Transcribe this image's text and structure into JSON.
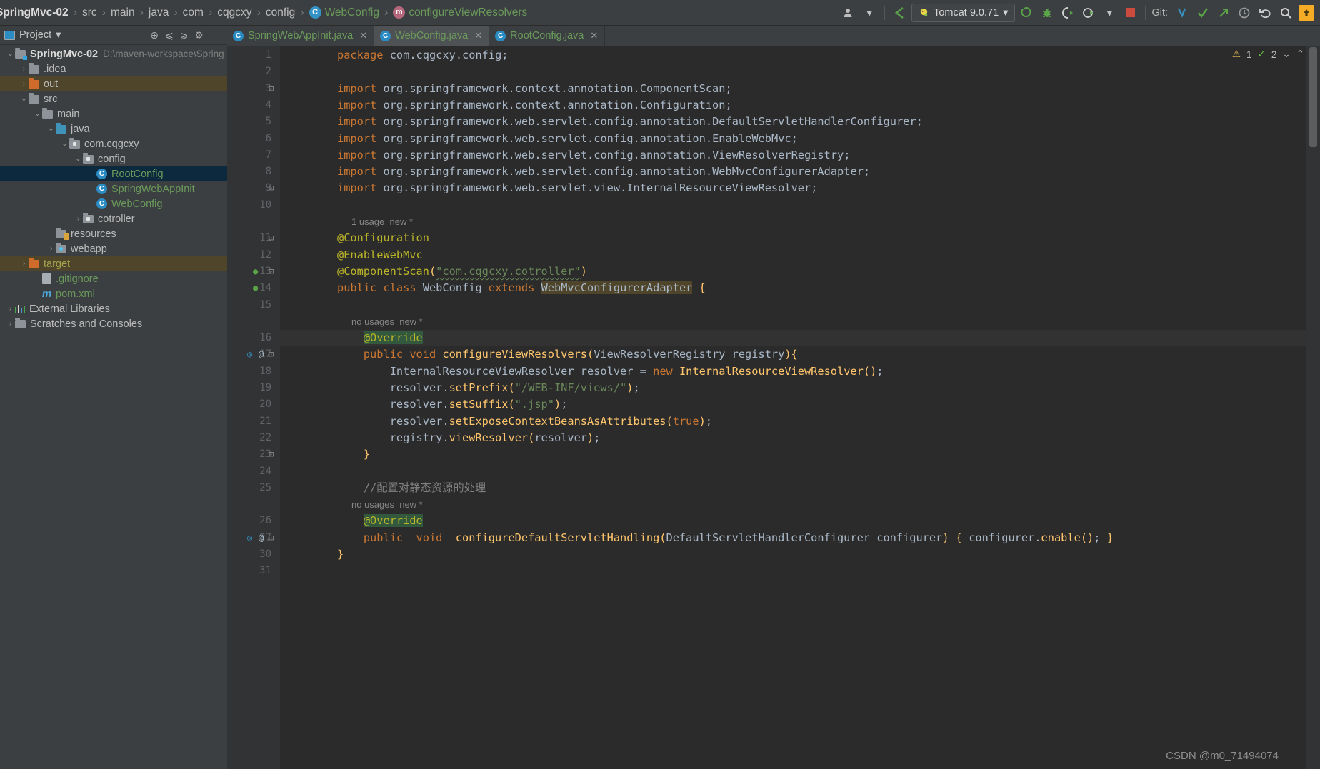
{
  "window": {
    "ide": "IntelliJ IDEA",
    "watermark": "CSDN @m0_71494074"
  },
  "breadcrumb": {
    "items": [
      {
        "label": "SpringMvc-02",
        "style": "bold",
        "icon": ""
      },
      {
        "label": "src",
        "style": "plain",
        "icon": ""
      },
      {
        "label": "main",
        "style": "plain",
        "icon": ""
      },
      {
        "label": "java",
        "style": "plain",
        "icon": ""
      },
      {
        "label": "com",
        "style": "plain",
        "icon": ""
      },
      {
        "label": "cqgcxy",
        "style": "plain",
        "icon": ""
      },
      {
        "label": "config",
        "style": "plain",
        "icon": ""
      },
      {
        "label": "WebConfig",
        "style": "green",
        "icon": "class-icon",
        "badge": "C"
      },
      {
        "label": "configureViewResolvers",
        "style": "green",
        "icon": "method-icon",
        "badge": "m"
      }
    ],
    "separator": "›"
  },
  "toolbar": {
    "profile_icon": "user-icon",
    "profile_caret": "▾",
    "back_icon": "back-arrow-icon",
    "run_config": {
      "icon": "tomcat-icon",
      "label": "Tomcat 9.0.71",
      "caret": "▾"
    },
    "run_icon": "run-icon",
    "debug_icon": "debug-icon",
    "run_coverage_icon": "run-with-coverage-icon",
    "profiler_icon": "profiler-icon",
    "profiler_caret": "▾",
    "stop_icon": "stop-icon",
    "git_label": "Git:",
    "git_update_icon": "update-project-icon",
    "git_commit_icon": "commit-icon",
    "git_push_icon": "push-icon",
    "history_icon": "history-icon",
    "rollback_icon": "rollback-icon",
    "search_icon": "search-everywhere-icon",
    "notify_icon": "update-available-icon"
  },
  "sidebar": {
    "title": "Project",
    "title_caret": "▾",
    "actions": [
      {
        "name": "select-opened-file-icon",
        "glyph": "⊕"
      },
      {
        "name": "expand-all-icon",
        "glyph": "⩽"
      },
      {
        "name": "collapse-all-icon",
        "glyph": "⩾"
      },
      {
        "name": "settings-gear-icon",
        "glyph": "⚙"
      },
      {
        "name": "hide-panel-icon",
        "glyph": "—"
      }
    ],
    "tree": [
      {
        "label": "SpringMvc-02",
        "detail": "D:\\maven-workspace\\Spring",
        "depth": 0,
        "arrow": "⌄",
        "icon": "module-folder",
        "style": "bold",
        "state": "normal"
      },
      {
        "label": ".idea",
        "detail": "",
        "depth": 1,
        "arrow": "›",
        "icon": "folder",
        "style": "plain",
        "state": "normal"
      },
      {
        "label": "out",
        "detail": "",
        "depth": 1,
        "arrow": "›",
        "icon": "folder-orange",
        "style": "plain",
        "state": "highlight"
      },
      {
        "label": "src",
        "detail": "",
        "depth": 1,
        "arrow": "⌄",
        "icon": "folder",
        "style": "plain",
        "state": "normal"
      },
      {
        "label": "main",
        "detail": "",
        "depth": 2,
        "arrow": "⌄",
        "icon": "folder",
        "style": "plain",
        "state": "normal"
      },
      {
        "label": "java",
        "detail": "",
        "depth": 3,
        "arrow": "⌄",
        "icon": "source-folder",
        "style": "plain",
        "state": "normal"
      },
      {
        "label": "com.cqgcxy",
        "detail": "",
        "depth": 4,
        "arrow": "⌄",
        "icon": "package",
        "style": "plain",
        "state": "normal"
      },
      {
        "label": "config",
        "detail": "",
        "depth": 5,
        "arrow": "⌄",
        "icon": "package",
        "style": "plain",
        "state": "normal"
      },
      {
        "label": "RootConfig",
        "detail": "",
        "depth": 6,
        "arrow": "",
        "icon": "java-class",
        "style": "green",
        "state": "selected"
      },
      {
        "label": "SpringWebAppInit",
        "detail": "",
        "depth": 6,
        "arrow": "",
        "icon": "java-class",
        "style": "green",
        "state": "normal"
      },
      {
        "label": "WebConfig",
        "detail": "",
        "depth": 6,
        "arrow": "",
        "icon": "java-class",
        "style": "green",
        "state": "normal"
      },
      {
        "label": "cotroller",
        "detail": "",
        "depth": 5,
        "arrow": "›",
        "icon": "package",
        "style": "plain",
        "state": "normal"
      },
      {
        "label": "resources",
        "detail": "",
        "depth": 3,
        "arrow": "",
        "icon": "resources-folder",
        "style": "plain",
        "state": "normal"
      },
      {
        "label": "webapp",
        "detail": "",
        "depth": 3,
        "arrow": "›",
        "icon": "webapp-folder",
        "style": "plain",
        "state": "normal"
      },
      {
        "label": "target",
        "detail": "",
        "depth": 1,
        "arrow": "›",
        "icon": "folder-orange",
        "style": "olive",
        "state": "highlight"
      },
      {
        "label": ".gitignore",
        "detail": "",
        "depth": 2,
        "arrow": "",
        "icon": "gitignore-file",
        "style": "green",
        "state": "normal"
      },
      {
        "label": "pom.xml",
        "detail": "",
        "depth": 2,
        "arrow": "",
        "icon": "maven-file",
        "style": "green",
        "state": "normal"
      },
      {
        "label": "External Libraries",
        "detail": "",
        "depth": 0,
        "arrow": "›",
        "icon": "libraries",
        "style": "plain",
        "state": "normal"
      },
      {
        "label": "Scratches and Consoles",
        "detail": "",
        "depth": 0,
        "arrow": "›",
        "icon": "scratches",
        "style": "plain",
        "state": "normal"
      }
    ]
  },
  "tabs": [
    {
      "label": "SpringWebAppInit.java",
      "badge": "C",
      "active": false,
      "close": "✕"
    },
    {
      "label": "WebConfig.java",
      "badge": "C",
      "active": true,
      "close": "✕"
    },
    {
      "label": "RootConfig.java",
      "badge": "C",
      "active": false,
      "close": "✕"
    }
  ],
  "inspector": {
    "warning_count": "1",
    "warning_icon": "warning-triangle-icon",
    "ok_count": "2",
    "ok_icon": "green-check-icon",
    "caret": "⌄",
    "chevron": "⌃"
  },
  "editor": {
    "file": "WebConfig.java",
    "current_line": 16,
    "lines": [
      {
        "no": "1",
        "y": 0,
        "text": "package com.cqgcxy.config;"
      },
      {
        "no": "2",
        "y": 1,
        "text": ""
      },
      {
        "no": "3",
        "y": 2,
        "text": "import org.springframework.context.annotation.ComponentScan;"
      },
      {
        "no": "4",
        "y": 3,
        "text": "import org.springframework.context.annotation.Configuration;"
      },
      {
        "no": "5",
        "y": 4,
        "text": "import org.springframework.web.servlet.config.annotation.DefaultServletHandlerConfigurer;"
      },
      {
        "no": "6",
        "y": 5,
        "text": "import org.springframework.web.servlet.config.annotation.EnableWebMvc;"
      },
      {
        "no": "7",
        "y": 6,
        "text": "import org.springframework.web.servlet.config.annotation.ViewResolverRegistry;"
      },
      {
        "no": "8",
        "y": 7,
        "text": "import org.springframework.web.servlet.config.annotation.WebMvcConfigurerAdapter;"
      },
      {
        "no": "9",
        "y": 8,
        "text": "import org.springframework.web.servlet.view.InternalResourceViewResolver;"
      },
      {
        "no": "10",
        "y": 9,
        "text": ""
      },
      {
        "no": "",
        "y": 10,
        "text": "1 usage  new *",
        "kind": "hint"
      },
      {
        "no": "11",
        "y": 11,
        "text": "@Configuration"
      },
      {
        "no": "12",
        "y": 12,
        "text": "@EnableWebMvc"
      },
      {
        "no": "13",
        "y": 13,
        "text": "@ComponentScan(\"com.cqgcxy.cotroller\")"
      },
      {
        "no": "14",
        "y": 14,
        "text": "public class WebConfig extends WebMvcConfigurerAdapter {"
      },
      {
        "no": "15",
        "y": 15,
        "text": ""
      },
      {
        "no": "",
        "y": 16,
        "text": "no usages  new *",
        "kind": "hint"
      },
      {
        "no": "16",
        "y": 17,
        "text": "    @Override"
      },
      {
        "no": "17",
        "y": 18,
        "text": "    public void configureViewResolvers(ViewResolverRegistry registry){"
      },
      {
        "no": "18",
        "y": 19,
        "text": "        InternalResourceViewResolver resolver = new InternalResourceViewResolver();"
      },
      {
        "no": "19",
        "y": 20,
        "text": "        resolver.setPrefix(\"/WEB-INF/views/\");"
      },
      {
        "no": "20",
        "y": 21,
        "text": "        resolver.setSuffix(\".jsp\");"
      },
      {
        "no": "21",
        "y": 22,
        "text": "        resolver.setExposeContextBeansAsAttributes(true);"
      },
      {
        "no": "22",
        "y": 23,
        "text": "        registry.viewResolver(resolver);"
      },
      {
        "no": "23",
        "y": 24,
        "text": "    }"
      },
      {
        "no": "24",
        "y": 25,
        "text": ""
      },
      {
        "no": "25",
        "y": 26,
        "text": "    //配置对静态资源的处理"
      },
      {
        "no": "",
        "y": 27,
        "text": "no usages  new *",
        "kind": "hint"
      },
      {
        "no": "26",
        "y": 28,
        "text": "    @Override"
      },
      {
        "no": "27",
        "y": 29,
        "text": "    public  void  configureDefaultServletHandling(DefaultServletHandlerConfigurer configurer) { configurer.enable(); }"
      },
      {
        "no": "30",
        "y": 30,
        "text": "}"
      },
      {
        "no": "31",
        "y": 31,
        "text": ""
      }
    ]
  }
}
